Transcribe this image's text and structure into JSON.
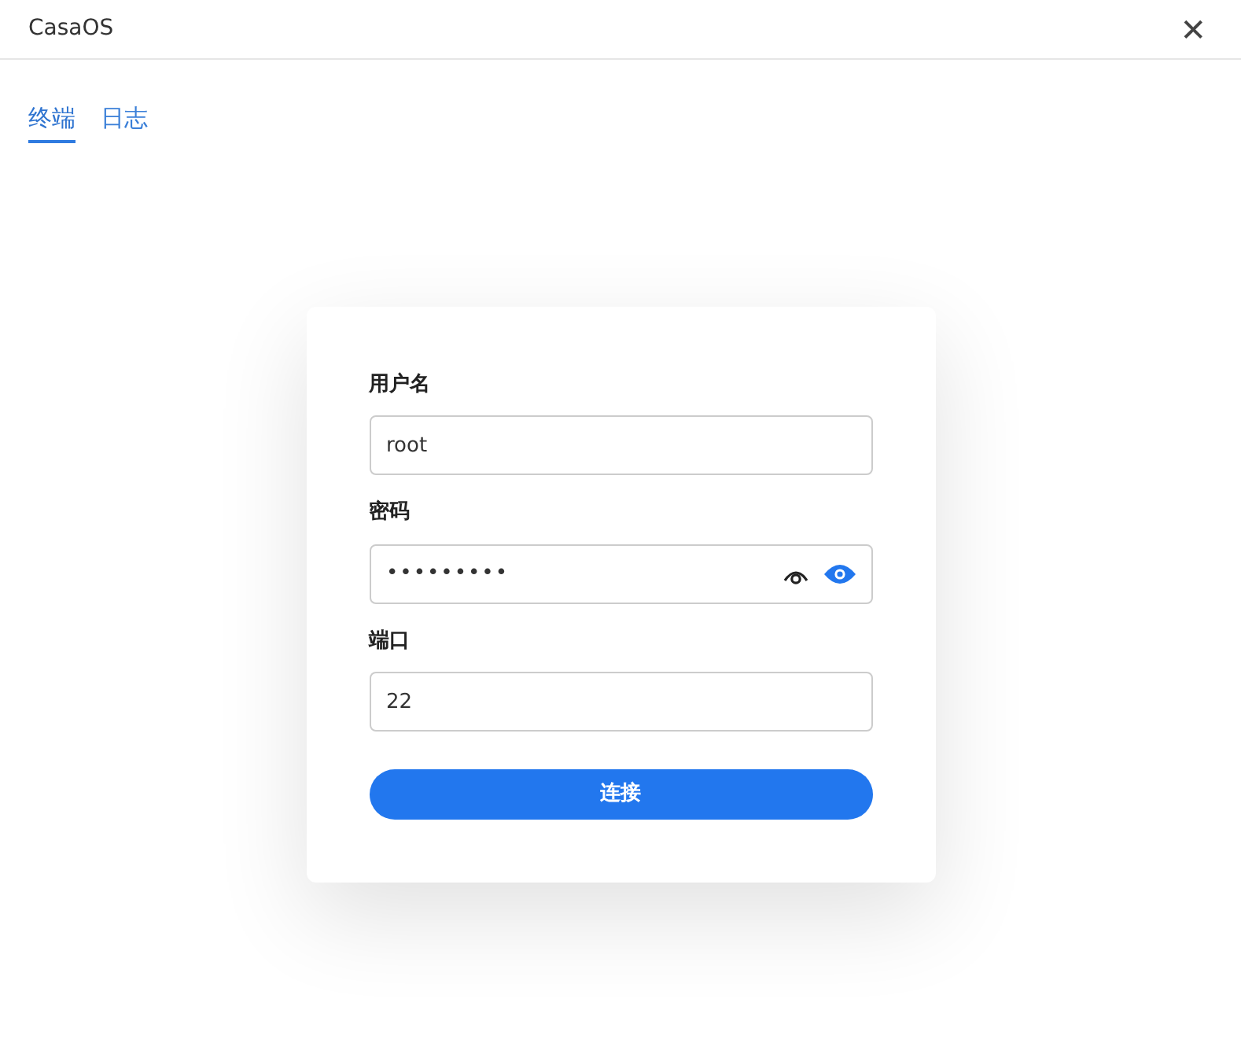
{
  "window": {
    "title": "CasaOS",
    "close": "✕"
  },
  "tabs": [
    {
      "label": "终端",
      "selected": true
    },
    {
      "label": "日志",
      "selected": false
    }
  ],
  "form": {
    "fields": [
      {
        "label": "用户名",
        "value": "root",
        "kind": "text"
      },
      {
        "label": "密码",
        "value": "•••••••••",
        "kind": "password"
      },
      {
        "label": "端口",
        "value": "22",
        "kind": "text"
      }
    ],
    "submit": "连接"
  }
}
